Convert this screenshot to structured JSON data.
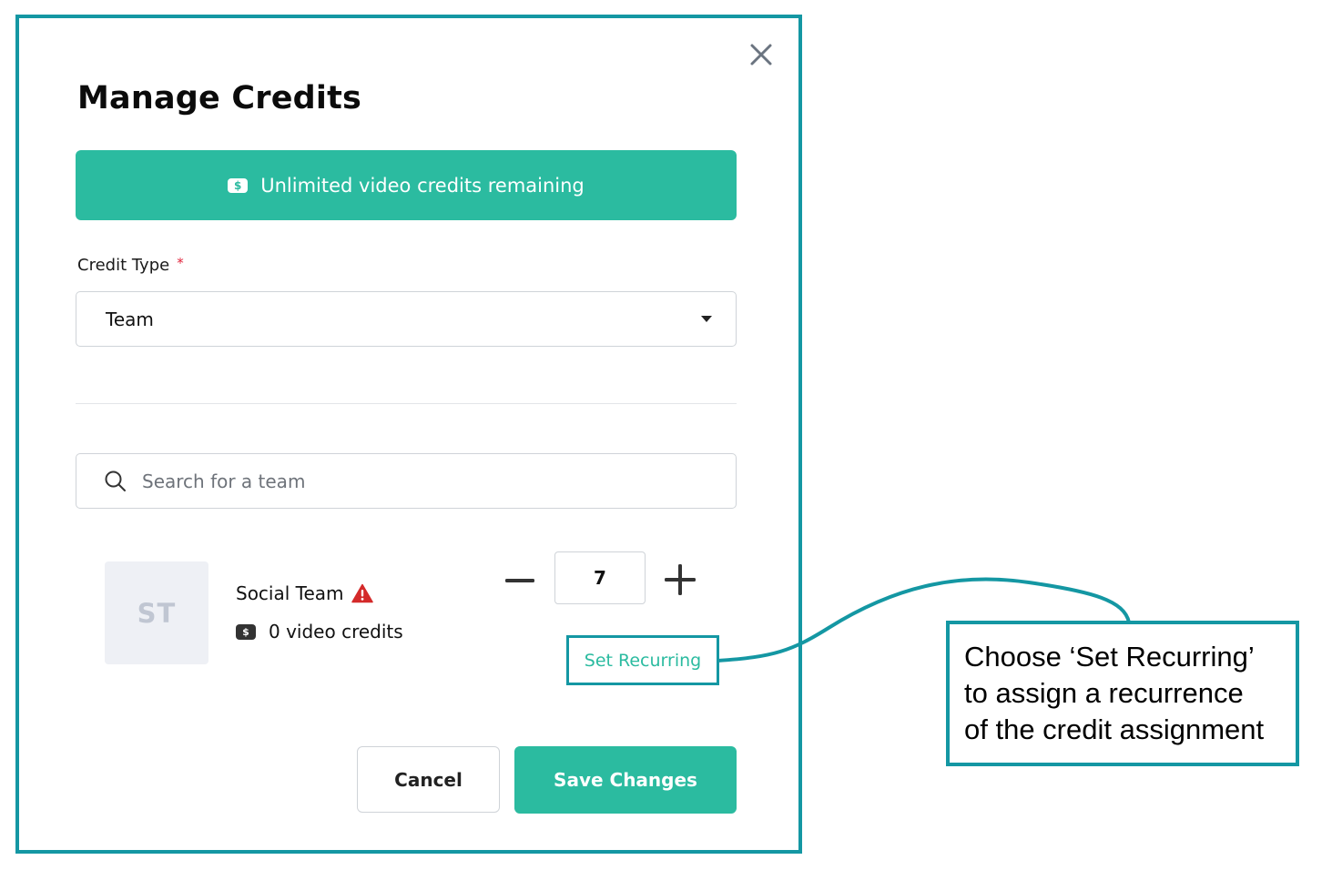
{
  "dialog": {
    "title": "Manage Credits",
    "close_icon": "close-icon"
  },
  "banner": {
    "icon": "dollar-icon",
    "text": "Unlimited video credits remaining"
  },
  "credit_type": {
    "label": "Credit Type",
    "required_marker": "*",
    "selected": "Team"
  },
  "search": {
    "icon": "search-icon",
    "placeholder": "Search for a team"
  },
  "team": {
    "avatar_initials": "ST",
    "name": "Social Team",
    "warning_icon": "warning-icon",
    "credits": "0 video credits",
    "quantity": "7",
    "set_recurring_label": "Set Recurring"
  },
  "actions": {
    "cancel_label": "Cancel",
    "save_label": "Save Changes"
  },
  "callout": {
    "lines": [
      "Choose ‘Set Recurring’",
      "to assign a recurrence",
      "of the credit assignment"
    ]
  },
  "colors": {
    "accent": "#2bbba0",
    "annotation_border": "#1497a3",
    "required": "#e0223a",
    "warning": "#d42a2a"
  }
}
